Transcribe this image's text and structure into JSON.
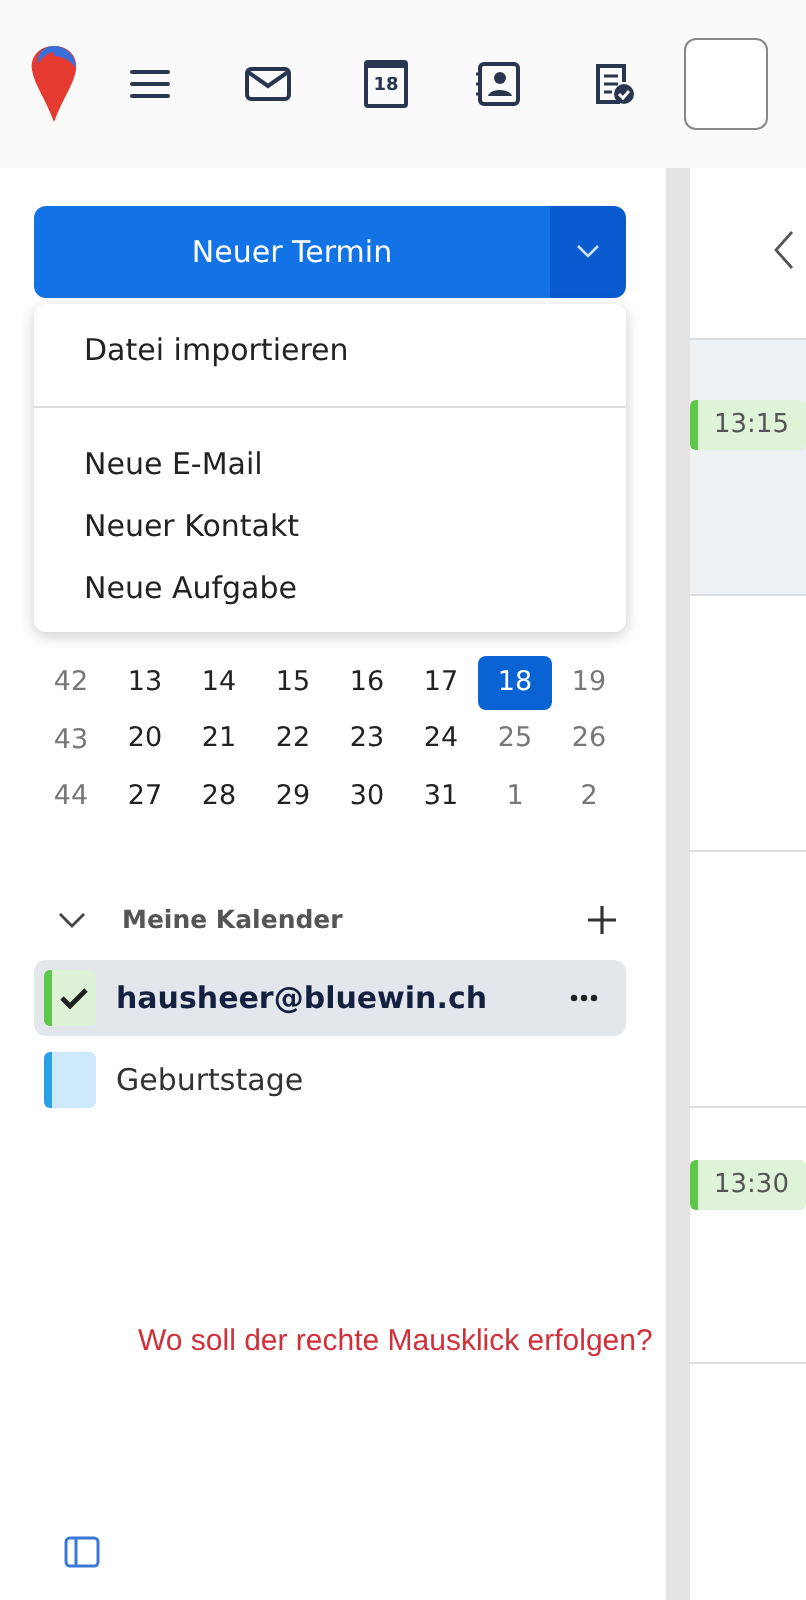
{
  "toolbar": {
    "calendar_icon_day": "18"
  },
  "new_button": {
    "label": "Neuer Termin"
  },
  "new_menu": {
    "items": [
      {
        "kind": "item",
        "label": "Datei importieren"
      },
      {
        "kind": "separator"
      },
      {
        "kind": "item",
        "label": "Neue E-Mail"
      },
      {
        "kind": "item",
        "label": "Neuer Kontakt"
      },
      {
        "kind": "item",
        "label": "Neue Aufgabe"
      }
    ]
  },
  "mini_calendar": {
    "weeks": [
      {
        "week": "42",
        "days": [
          {
            "day": "13",
            "selected": false,
            "weekend": false
          },
          {
            "day": "14",
            "selected": false,
            "weekend": false
          },
          {
            "day": "15",
            "selected": false,
            "weekend": false
          },
          {
            "day": "16",
            "selected": false,
            "weekend": false
          },
          {
            "day": "17",
            "selected": false,
            "weekend": false
          },
          {
            "day": "18",
            "selected": true,
            "weekend": true
          },
          {
            "day": "19",
            "selected": false,
            "weekend": true
          }
        ]
      },
      {
        "week": "43",
        "days": [
          {
            "day": "20",
            "selected": false,
            "weekend": false
          },
          {
            "day": "21",
            "selected": false,
            "weekend": false
          },
          {
            "day": "22",
            "selected": false,
            "weekend": false
          },
          {
            "day": "23",
            "selected": false,
            "weekend": false
          },
          {
            "day": "24",
            "selected": false,
            "weekend": false
          },
          {
            "day": "25",
            "selected": false,
            "weekend": true
          },
          {
            "day": "26",
            "selected": false,
            "weekend": true
          }
        ]
      },
      {
        "week": "44",
        "days": [
          {
            "day": "27",
            "selected": false,
            "weekend": false
          },
          {
            "day": "28",
            "selected": false,
            "weekend": false
          },
          {
            "day": "29",
            "selected": false,
            "weekend": false
          },
          {
            "day": "30",
            "selected": false,
            "weekend": false
          },
          {
            "day": "31",
            "selected": false,
            "weekend": false
          },
          {
            "day": "1",
            "selected": false,
            "weekend": true
          },
          {
            "day": "2",
            "selected": false,
            "weekend": true
          }
        ]
      }
    ]
  },
  "my_calendars": {
    "title": "Meine Kalender",
    "expanded": true,
    "items": [
      {
        "name": "hausheer@bluewin.ch",
        "selected": true,
        "checked": true,
        "color": "#5cc84a"
      },
      {
        "name": "Geburtstage",
        "selected": false,
        "checked": false,
        "color": "#2aa0e6"
      }
    ]
  },
  "events": [
    {
      "time": "13:15",
      "color": "#5cc84a"
    },
    {
      "time": "13:30",
      "color": "#5cc84a"
    }
  ],
  "annotation": "Wo soll der rechte Mausklick erfolgen?"
}
